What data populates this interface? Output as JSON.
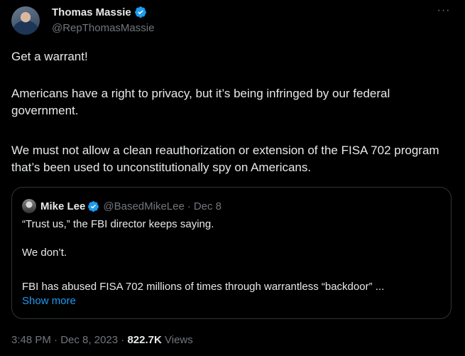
{
  "tweet": {
    "author_name": "Thomas Massie",
    "author_handle": "@RepThomasMassie",
    "paragraphs": [
      "Get a warrant!",
      "Americans have a right to privacy, but it’s being infringed by our federal government.",
      "We must not allow a clean reauthorization or extension of the FISA 702 program that’s been used to unconstitutionally spy on Americans."
    ],
    "more_label": "···",
    "time": "3:48 PM",
    "date": "Dec 8, 2023",
    "separator": "·",
    "views_count": "822.7K",
    "views_label": "Views"
  },
  "quote": {
    "author_name": "Mike Lee",
    "author_handle": "@BasedMikeLee",
    "date": "Dec 8",
    "separator": "·",
    "lines": [
      "“Trust us,” the FBI director keeps saying.",
      "We don’t.",
      "FBI has abused FISA 702 millions of times through warrantless “backdoor” ..."
    ],
    "show_more": "Show more"
  },
  "colors": {
    "background": "#000000",
    "text": "#e7e9ea",
    "muted": "#71767b",
    "accent": "#1d9bf0",
    "border": "#2f3336"
  },
  "icons": [
    "verified-badge-icon",
    "more-icon"
  ]
}
